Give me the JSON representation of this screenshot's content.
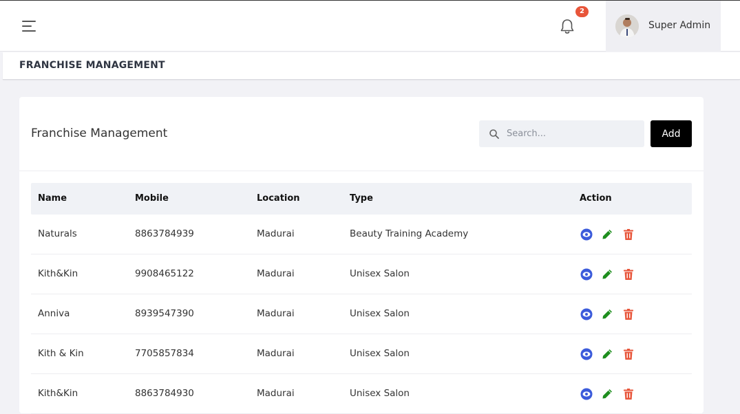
{
  "header": {
    "notification_count": "2",
    "user_name": "Super Admin"
  },
  "breadcrumb": {
    "title": "FRANCHISE MANAGEMENT"
  },
  "card": {
    "title": "Franchise Management",
    "search_placeholder": "Search...",
    "add_label": "Add"
  },
  "table": {
    "columns": [
      "Name",
      "Mobile",
      "Location",
      "Type",
      "Action"
    ],
    "rows": [
      {
        "name": "Naturals",
        "mobile": "8863784939",
        "location": "Madurai",
        "type": "Beauty Training Academy"
      },
      {
        "name": "Kith&Kin",
        "mobile": "9908465122",
        "location": "Madurai",
        "type": "Unisex Salon"
      },
      {
        "name": "Anniva",
        "mobile": "8939547390",
        "location": "Madurai",
        "type": "Unisex Salon"
      },
      {
        "name": "Kith & Kin",
        "mobile": "7705857834",
        "location": "Madurai",
        "type": "Unisex Salon"
      },
      {
        "name": "Kith&Kin",
        "mobile": "8863784930",
        "location": "Madurai",
        "type": "Unisex Salon"
      }
    ]
  },
  "colors": {
    "view_icon": "#3b5bdb",
    "edit_icon": "#1e8e1e",
    "delete_icon": "#e8553a",
    "badge": "#e8553a",
    "add_button": "#000000"
  },
  "icons": {
    "menu": "hamburger-menu-icon",
    "notifications": "bell-icon",
    "search": "search-icon",
    "view": "eye-icon",
    "edit": "pencil-icon",
    "delete": "trash-icon"
  }
}
